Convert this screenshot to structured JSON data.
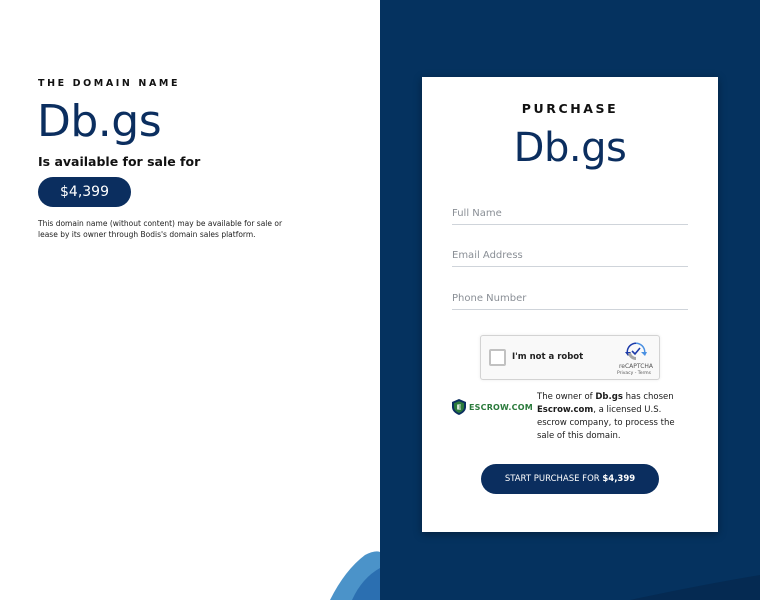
{
  "left": {
    "eyebrow": "THE DOMAIN NAME",
    "domain": "Db.gs",
    "available_text": "Is available for sale for",
    "price": "$4,399",
    "disclaimer": "This domain name (without content) may be available for sale or lease by its owner through Bodis's domain sales platform."
  },
  "card": {
    "eyebrow": "PURCHASE",
    "domain": "Db.gs",
    "fields": {
      "full_name_placeholder": "Full Name",
      "email_placeholder": "Email Address",
      "phone_placeholder": "Phone Number"
    },
    "captcha": {
      "label": "I'm not a robot",
      "brand": "reCAPTCHA",
      "links": "Privacy - Terms"
    },
    "escrow": {
      "logo_text": "ESCROW.COM",
      "copy_prefix": "The owner of ",
      "copy_domain": "Db.gs",
      "copy_mid": " has chosen ",
      "copy_escrow": "Escrow.com",
      "copy_suffix": ", a licensed U.S. escrow company, to process the sale of this domain."
    },
    "cta": {
      "label": "START PURCHASE FOR ",
      "amount": "$4,399"
    }
  },
  "colors": {
    "brand_navy": "#0b2e5f",
    "panel_navy": "#05325f",
    "escrow_green": "#2a7a3b"
  }
}
